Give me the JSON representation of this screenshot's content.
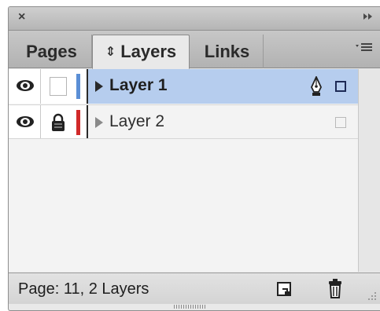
{
  "titlebar": {
    "close_icon": "close-icon",
    "collapse_icon": "double-chevron-right-icon",
    "close_label": "×"
  },
  "tabs": [
    {
      "label": "Pages",
      "active": false
    },
    {
      "label": "Layers",
      "active": true,
      "icon": "sort-updown-icon"
    },
    {
      "label": "Links",
      "active": false
    }
  ],
  "panel_menu_icon": "panel-menu-icon",
  "layers": [
    {
      "name": "Layer 1",
      "visible": true,
      "locked": false,
      "color": "#5b8fd6",
      "selected": true,
      "expanded": false,
      "target_icon": "pen-nib-icon"
    },
    {
      "name": "Layer 2",
      "visible": true,
      "locked": true,
      "color": "#d12a2a",
      "selected": false,
      "expanded": false
    }
  ],
  "status": {
    "text": "Page: 11, 2 Layers"
  },
  "footer_buttons": [
    {
      "icon": "new-layer-icon"
    },
    {
      "icon": "trash-icon"
    }
  ]
}
